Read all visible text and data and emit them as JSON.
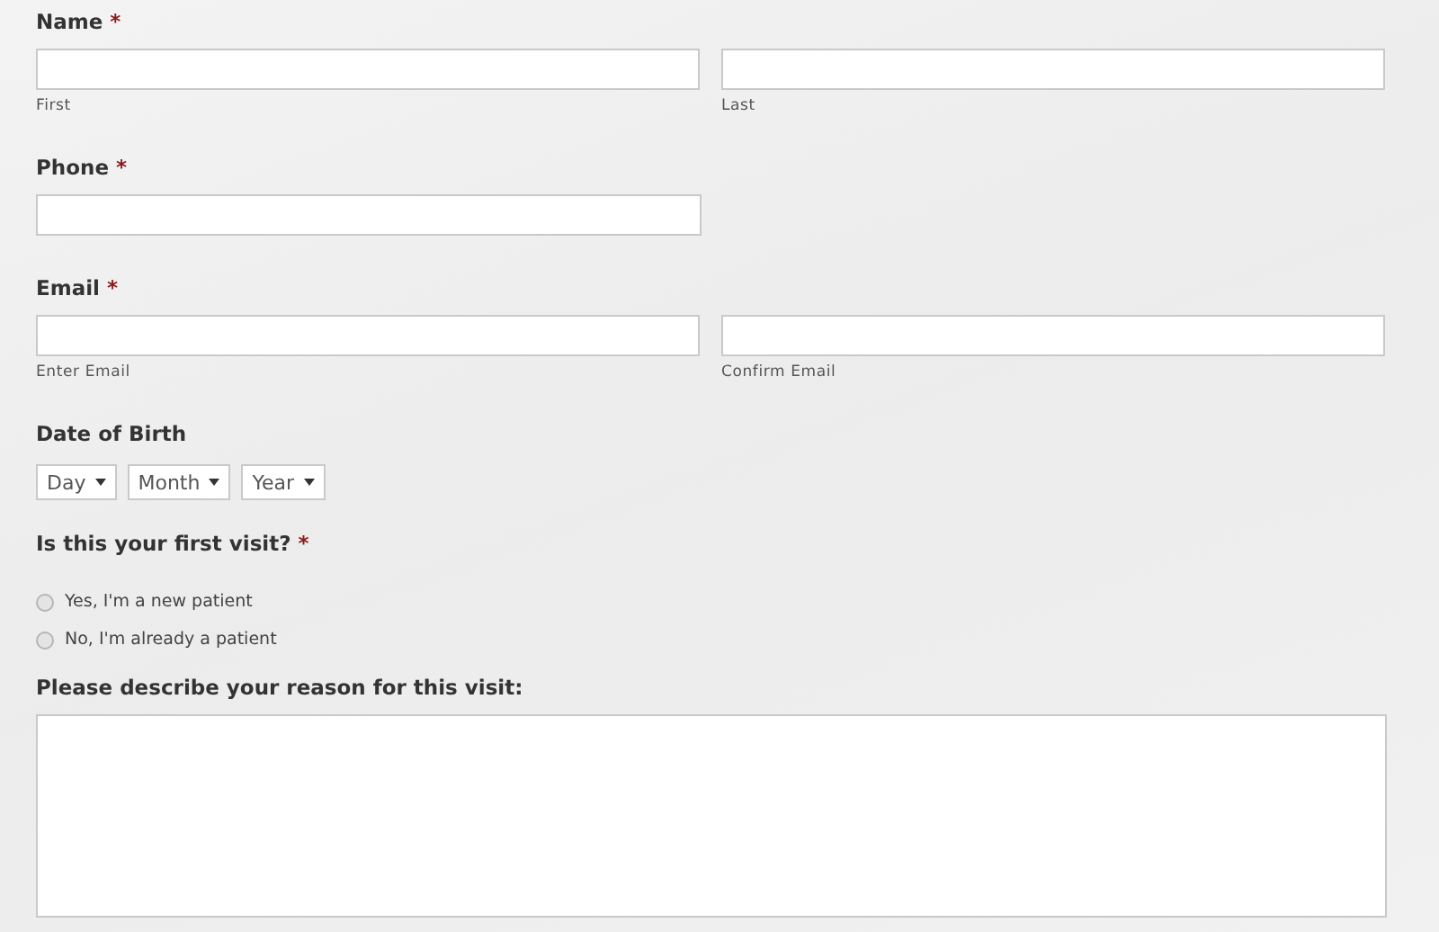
{
  "sections": [
    {
      "kind": "pair",
      "label": "Name",
      "required_mark": "*",
      "sublabels": [
        "First",
        "Last"
      ]
    },
    {
      "kind": "single",
      "label": "Phone",
      "required_mark": "*"
    },
    {
      "kind": "pair",
      "label": "Email",
      "required_mark": "*",
      "sublabels": [
        "Enter Email",
        "Confirm Email"
      ]
    },
    {
      "kind": "date",
      "label": "Date of Birth",
      "selects": [
        "Day",
        "Month",
        "Year"
      ]
    },
    {
      "kind": "radio",
      "label": "Is this your first visit?",
      "required_mark": "*",
      "options": [
        {
          "label": "Yes, I'm a new patient",
          "selected": false
        },
        {
          "label": "No, I'm already a patient",
          "selected": false
        }
      ]
    },
    {
      "kind": "textarea",
      "label": "Please describe your reason for this visit:"
    }
  ]
}
